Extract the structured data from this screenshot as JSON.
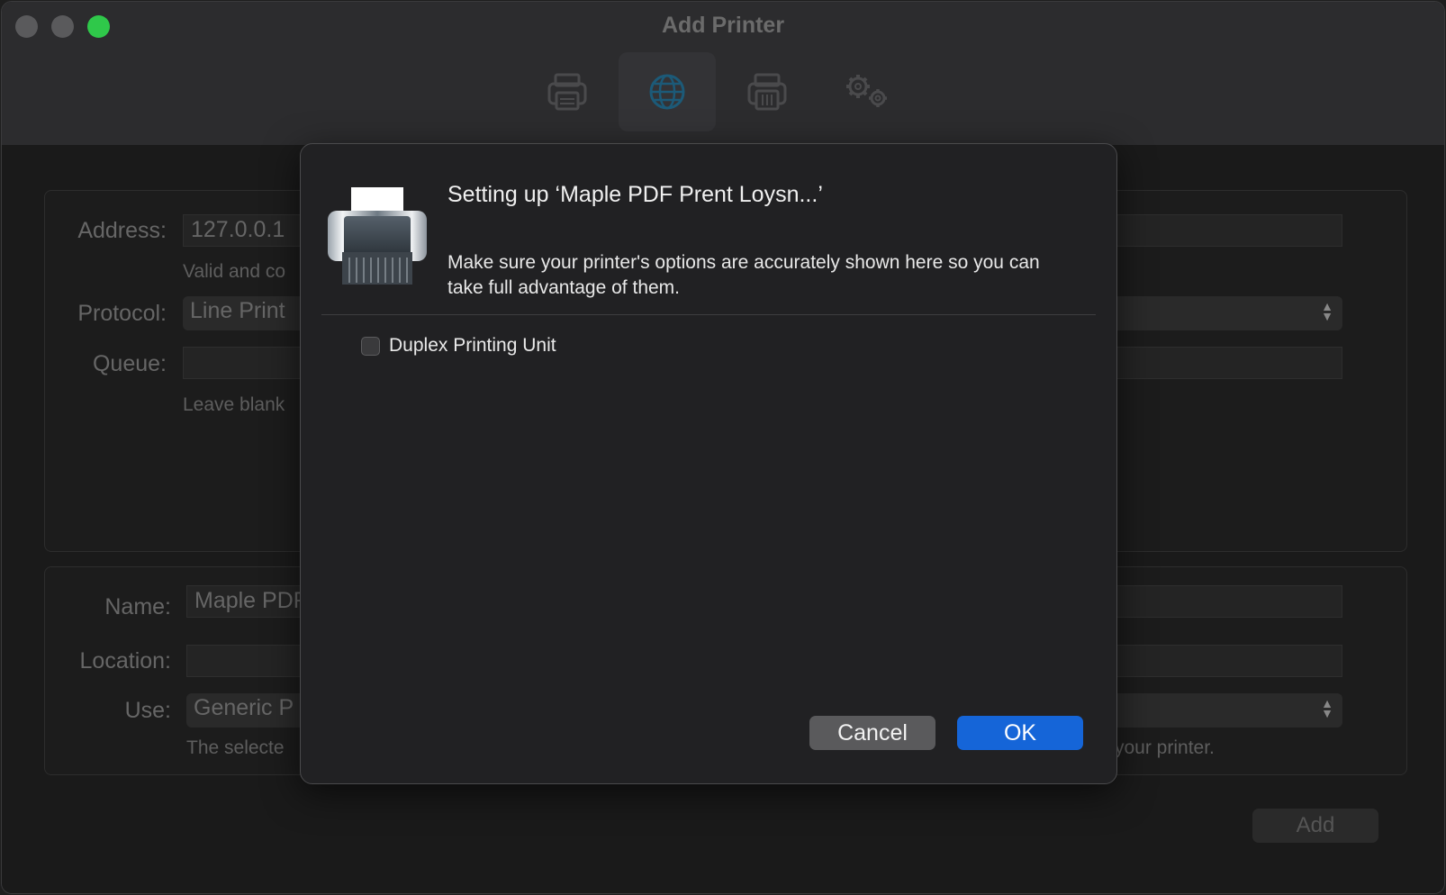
{
  "window": {
    "title": "Add Printer"
  },
  "toolbar": {
    "items": [
      {
        "icon": "default-printer-icon",
        "active": false
      },
      {
        "icon": "ip-globe-icon",
        "active": true
      },
      {
        "icon": "windows-printer-icon",
        "active": false
      },
      {
        "icon": "advanced-gears-icon",
        "active": false
      }
    ]
  },
  "form": {
    "address_label": "Address:",
    "address_value": "127.0.0.1",
    "address_hint": "Valid and co",
    "protocol_label": "Protocol:",
    "protocol_value": "Line Print",
    "queue_label": "Queue:",
    "queue_hint": "Leave blank",
    "name_label": "Name:",
    "name_value": "Maple PDF",
    "location_label": "Location:",
    "use_label": "Use:",
    "use_value": "Generic P",
    "use_hint_left": "The selecte",
    "use_hint_right": "your printer.",
    "add_label": "Add"
  },
  "sheet": {
    "title": "Setting up ‘Maple PDF Prent Loysn...’",
    "message": "Make sure your printer's options are accurately shown here so you can take full advantage of them.",
    "options": [
      {
        "label": "Duplex Printing Unit",
        "checked": false
      }
    ],
    "cancel_label": "Cancel",
    "ok_label": "OK"
  },
  "colors": {
    "accent": "#1565d8",
    "zoom": "#2fc84a"
  }
}
